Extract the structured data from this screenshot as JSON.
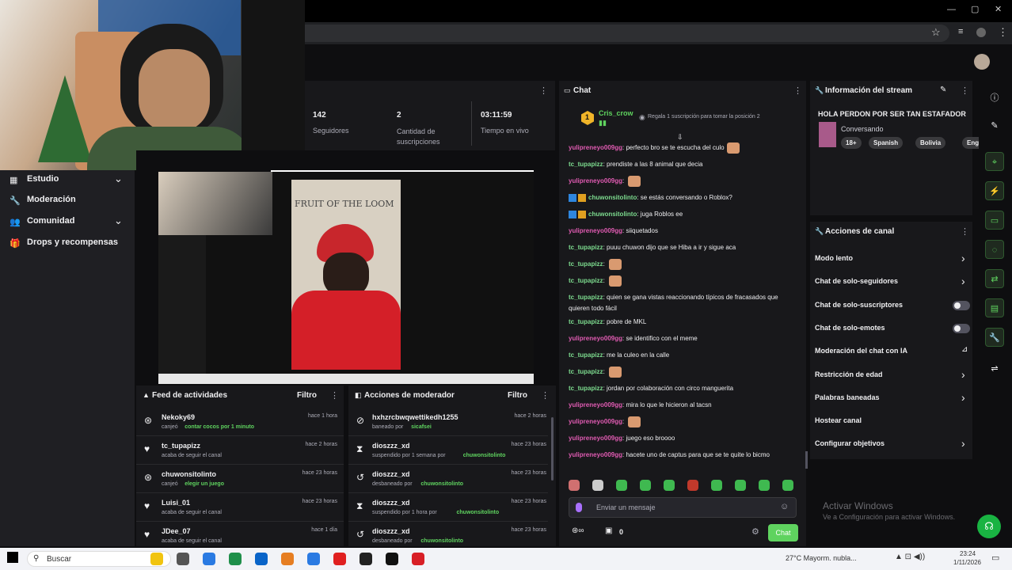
{
  "browser": {
    "controls": [
      "—",
      "▢",
      "✕"
    ]
  },
  "stats": [
    {
      "value": "142",
      "label": "Seguidores"
    },
    {
      "value": "2",
      "label": "Cantidad de suscripciones"
    },
    {
      "value": "03:11:59",
      "label": "Tiempo en vivo"
    }
  ],
  "sidebar": {
    "items": [
      {
        "label": "Estudio",
        "icon": "studio-icon",
        "chevron": true
      },
      {
        "label": "Moderación",
        "icon": "wrench-icon",
        "chevron": false
      },
      {
        "label": "Comunidad",
        "icon": "people-icon",
        "chevron": true
      },
      {
        "label": "Drops y recompensas",
        "icon": "gift-icon",
        "chevron": false
      }
    ]
  },
  "preview": {
    "video_title": "FRUIT OF THE LOOM"
  },
  "activity_feed": {
    "title": "Feed de actividades",
    "filter": "Filtro",
    "items": [
      {
        "name": "Nekoky69",
        "time": "hace 1 hora",
        "prefix": "canjeó",
        "highlight": "contar cocos por 1 minuto",
        "icon": "points-icon"
      },
      {
        "name": "tc_tupapizz",
        "time": "hace 2 horas",
        "prefix": "acaba de seguir el canal",
        "highlight": "",
        "icon": "heart-icon"
      },
      {
        "name": "chuwonsitolinto",
        "time": "hace 23 horas",
        "prefix": "canjeó",
        "highlight": "elegir un juego",
        "icon": "points-icon"
      },
      {
        "name": "Luisi_01",
        "time": "hace 23 horas",
        "prefix": "acaba de seguir el canal",
        "highlight": "",
        "icon": "heart-icon"
      },
      {
        "name": "JDee_07",
        "time": "hace 1 día",
        "prefix": "acaba de seguir el canal",
        "highlight": "",
        "icon": "heart-icon"
      }
    ]
  },
  "mod_actions": {
    "title": "Acciones de moderador",
    "filter": "Filtro",
    "items": [
      {
        "name": "hxhzrcbwqwettikedh1255",
        "time": "hace 2 horas",
        "prefix": "baneado por",
        "by": "sicafsei",
        "icon": "ban-icon"
      },
      {
        "name": "dioszzz_xd",
        "time": "hace 23 horas",
        "prefix": "suspendido por 1 semana por",
        "by": "chuwonsitolinto",
        "icon": "hourglass-icon"
      },
      {
        "name": "dioszzz_xd",
        "time": "hace 23 horas",
        "prefix": "desbaneado por",
        "by": "chuwonsitolinto",
        "icon": "undo-icon"
      },
      {
        "name": "dioszzz_xd",
        "time": "hace 23 horas",
        "prefix": "suspendido por 1 hora por",
        "by": "chuwonsitolinto",
        "icon": "hourglass-icon"
      },
      {
        "name": "dioszzz_xd",
        "time": "hace 23 horas",
        "prefix": "desbaneado por",
        "by": "chuwonsitolinto",
        "icon": "undo-icon"
      }
    ]
  },
  "chat": {
    "title": "Chat",
    "top_user": "Cris_crow",
    "top_badge": "1",
    "top_gift_text": "Regala 1 suscripción para tomar la posición 2",
    "messages": [
      {
        "user": "yulipreneyo009gg",
        "color": "pink",
        "text": "perfecto bro se te escucha del culo",
        "badges": false,
        "emote": true
      },
      {
        "user": "tc_tupapizz",
        "color": "teal",
        "text": "prendiste a las 8 animal que decia",
        "badges": false,
        "emote": false
      },
      {
        "user": "yulipreneyo009gg",
        "color": "pink",
        "text": "",
        "badges": false,
        "emote": true
      },
      {
        "user": "chuwonsitolinto",
        "color": "teal",
        "text": "se estás conversando o Roblox?",
        "badges": true,
        "emote": false
      },
      {
        "user": "chuwonsitolinto",
        "color": "teal",
        "text": "juga Roblos ee",
        "badges": true,
        "emote": false
      },
      {
        "user": "yulipreneyo009gg",
        "color": "pink",
        "text": "siiquetados",
        "badges": false,
        "emote": false
      },
      {
        "user": "tc_tupapizz",
        "color": "teal",
        "text": "puuu chuwon dijo que se Hiba a ir y sigue aca",
        "badges": false,
        "emote": false
      },
      {
        "user": "tc_tupapizz",
        "color": "teal",
        "text": "",
        "badges": false,
        "emote": true
      },
      {
        "user": "tc_tupapizz",
        "color": "teal",
        "text": "",
        "badges": false,
        "emote": true
      },
      {
        "user": "tc_tupapizz",
        "color": "teal",
        "text": "quien se gana vistas reaccionando típicos de fracasados que quieren todo fácil",
        "badges": false,
        "emote": false
      },
      {
        "user": "tc_tupapizz",
        "color": "teal",
        "text": "pobre de MKL",
        "badges": false,
        "emote": false
      },
      {
        "user": "yulipreneyo009gg",
        "color": "pink",
        "text": "se identifico con el meme",
        "badges": false,
        "emote": false
      },
      {
        "user": "tc_tupapizz",
        "color": "teal",
        "text": "me la culeo en la calle",
        "badges": false,
        "emote": false
      },
      {
        "user": "tc_tupapizz",
        "color": "teal",
        "text": "",
        "badges": false,
        "emote": true
      },
      {
        "user": "tc_tupapizz",
        "color": "teal",
        "text": "jordan por colaboración con circo manguerita",
        "badges": false,
        "emote": false
      },
      {
        "user": "yulipreneyo009gg",
        "color": "pink",
        "text": "mira lo que le hicieron al tacsn",
        "badges": false,
        "emote": false
      },
      {
        "user": "yulipreneyo009gg",
        "color": "pink",
        "text": "",
        "badges": false,
        "emote": true
      },
      {
        "user": "yulipreneyo009gg",
        "color": "pink",
        "text": "juego eso broooo",
        "badges": false,
        "emote": false
      },
      {
        "user": "yulipreneyo009gg",
        "color": "pink",
        "text": "hacete uno de captus para que se te quite lo bicmo",
        "badges": false,
        "emote": false
      }
    ],
    "input_placeholder": "Enviar un mensaje",
    "send_label": "Chat",
    "points": "0"
  },
  "stream_info": {
    "title": "Información del stream",
    "stream_title": "HOLA PERDON POR SER TAN ESTAFADOR",
    "category": "Conversando",
    "tags": [
      "18+",
      "Spanish",
      "Bolivia",
      "English"
    ]
  },
  "channel_actions": {
    "title": "Acciones de canal",
    "items": [
      {
        "label": "Modo lento",
        "control": "chevron"
      },
      {
        "label": "Chat de solo-seguidores",
        "control": "chevron"
      },
      {
        "label": "Chat de solo-suscriptores",
        "control": "toggle"
      },
      {
        "label": "Chat de solo-emotes",
        "control": "toggle"
      },
      {
        "label": "Moderación del chat con IA",
        "control": "icon"
      },
      {
        "label": "Restricción de edad",
        "control": "chevron"
      },
      {
        "label": "Palabras baneadas",
        "control": "chevron"
      },
      {
        "label": "Hostear canal",
        "control": "none"
      },
      {
        "label": "Configurar objetivos",
        "control": "chevron"
      }
    ]
  },
  "watermark": {
    "line1": "Activar Windows",
    "line2": "Ve a Configuración para activar Windows."
  },
  "taskbar": {
    "search": "Buscar",
    "weather": "27°C  Mayorm. nubla...",
    "time": "23:24",
    "date": "1/11/2026"
  },
  "colors": {
    "accent": "#5fd35f",
    "pink": "#e05bb2",
    "teal": "#7ddc8f",
    "panel": "#18181b",
    "bg": "#0e0e10"
  }
}
